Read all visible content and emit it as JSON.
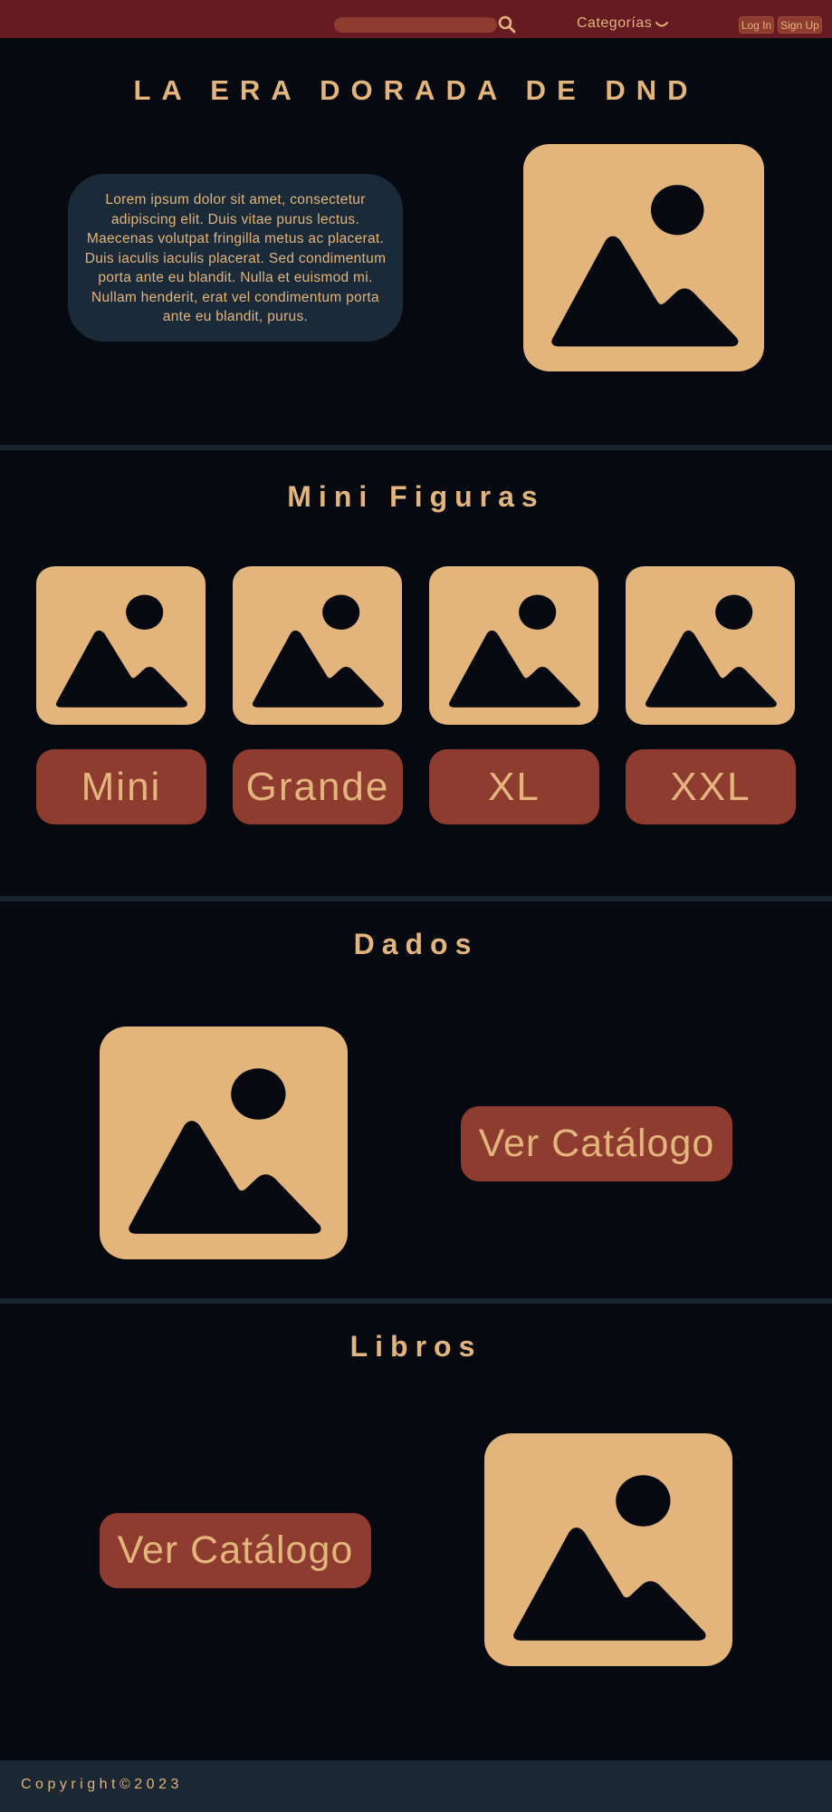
{
  "header": {
    "search": {
      "placeholder": ""
    },
    "categories_label": "Categorías",
    "login_label": "Log In",
    "signup_label": "Sign Up"
  },
  "hero": {
    "title": "LA ERA DORADA DE DND",
    "text": "Lorem ipsum dolor sit amet, consectetur adipiscing elit. Duis vitae purus lectus. Maecenas volutpat fringilla metus ac placerat. Duis iaculis iaculis placerat. Sed condimentum porta ante eu blandit. Nulla et euismod mi. Nullam henderit, erat vel condimentum porta ante eu blandit, purus."
  },
  "mini_figuras": {
    "title": "Mini Figuras",
    "buttons": [
      "Mini",
      "Grande",
      "XL",
      "XXL"
    ]
  },
  "dados": {
    "title": "Dados",
    "button_label": "Ver Catálogo"
  },
  "libros": {
    "title": "Libros",
    "button_label": "Ver Catálogo"
  },
  "footer": {
    "copyright": "Copyright©2023"
  },
  "colors": {
    "header_bg": "#661a21",
    "page_bg": "#060a10",
    "accent_gold": "#e3b47b",
    "button_bg": "#8e3c30",
    "panel_bg": "#1b2a38"
  },
  "icons": {
    "search": "search-icon",
    "chevron": "chevron-down-icon",
    "image_placeholder": "image-placeholder-icon"
  }
}
